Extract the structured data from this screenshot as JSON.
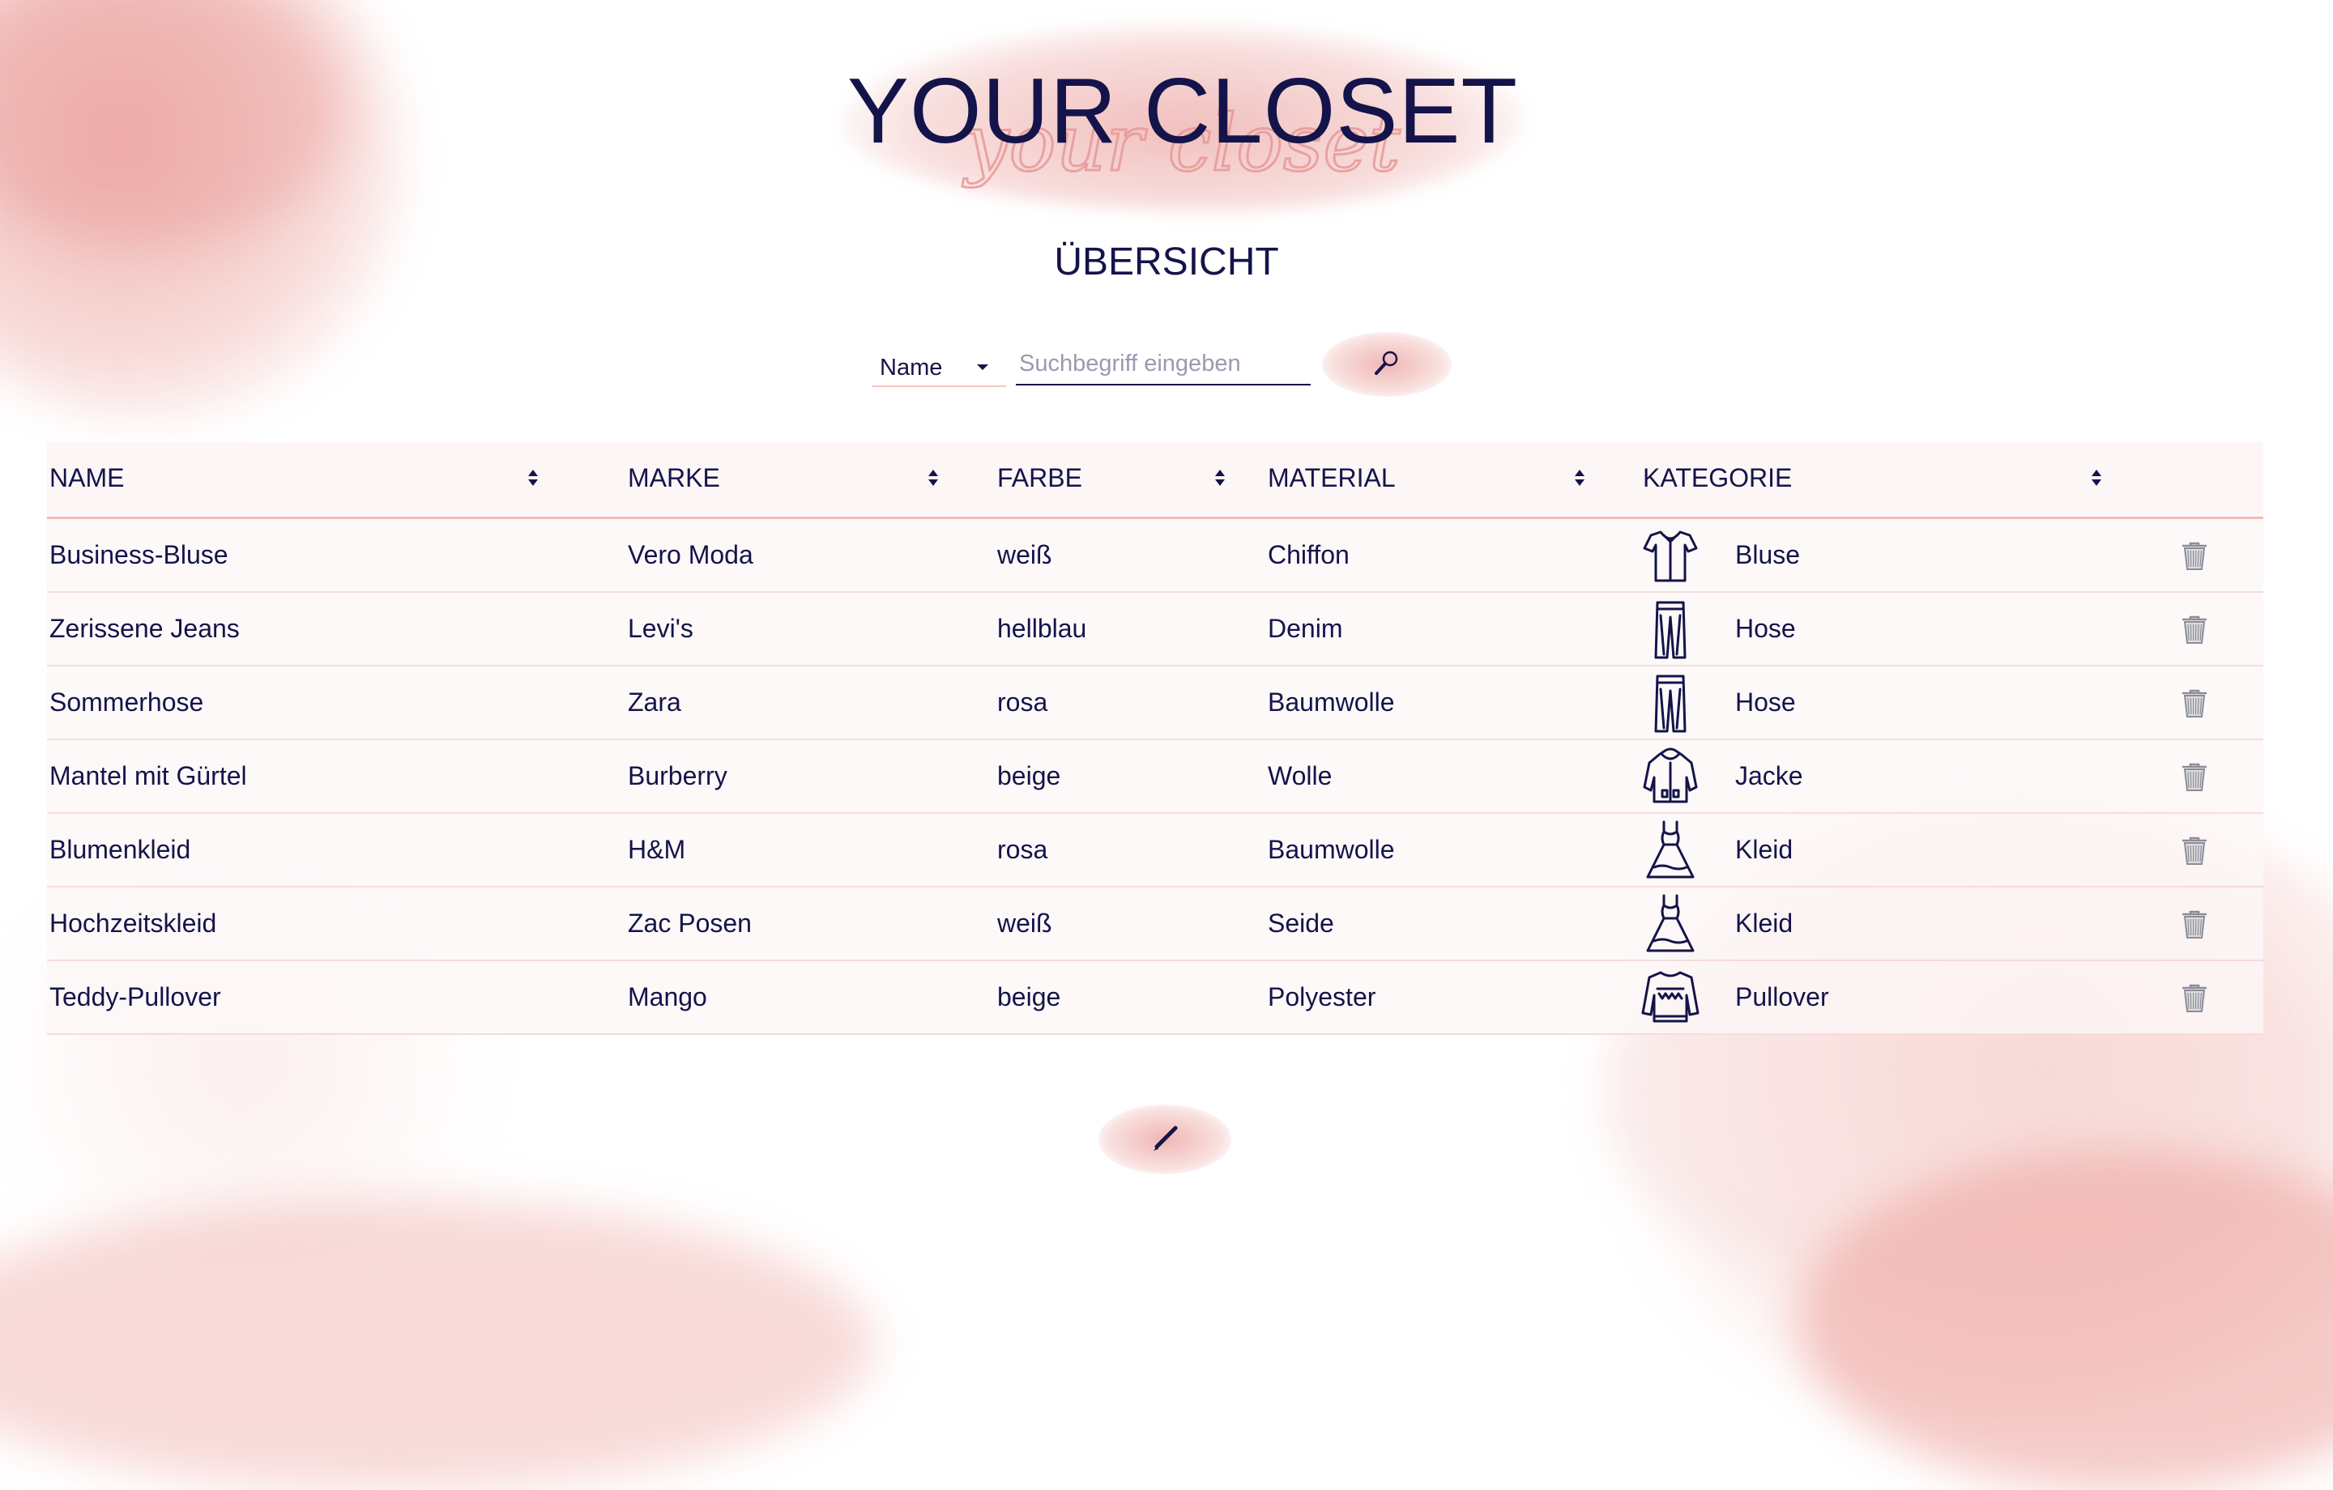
{
  "header": {
    "title": "YOUR CLOSET",
    "script_text": "your closet"
  },
  "subtitle": "ÜBERSICHT",
  "search": {
    "field_selected": "Name",
    "placeholder": "Suchbegriff eingeben",
    "button_icon": "magnifier-icon"
  },
  "table": {
    "columns": [
      "NAME",
      "MARKE",
      "FARBE",
      "MATERIAL",
      "KATEGORIE"
    ],
    "rows": [
      {
        "name": "Business-Bluse",
        "brand": "Vero Moda",
        "color": "weiß",
        "material": "Chiffon",
        "category": "Bluse",
        "icon": "blouse-icon"
      },
      {
        "name": "Zerissene Jeans",
        "brand": "Levi's",
        "color": "hellblau",
        "material": "Denim",
        "category": "Hose",
        "icon": "pants-icon"
      },
      {
        "name": "Sommerhose",
        "brand": "Zara",
        "color": "rosa",
        "material": "Baumwolle",
        "category": "Hose",
        "icon": "pants-icon"
      },
      {
        "name": "Mantel mit Gürtel",
        "brand": "Burberry",
        "color": "beige",
        "material": "Wolle",
        "category": "Jacke",
        "icon": "jacket-icon"
      },
      {
        "name": "Blumenkleid",
        "brand": "H&M",
        "color": "rosa",
        "material": "Baumwolle",
        "category": "Kleid",
        "icon": "dress-icon"
      },
      {
        "name": "Hochzeitskleid",
        "brand": "Zac Posen",
        "color": "weiß",
        "material": "Seide",
        "category": "Kleid",
        "icon": "dress-icon"
      },
      {
        "name": "Teddy-Pullover",
        "brand": "Mango",
        "color": "beige",
        "material": "Polyester",
        "category": "Pullover",
        "icon": "sweater-icon"
      }
    ]
  },
  "colors": {
    "text": "#14144a",
    "accent": "#ecaaa6",
    "row_bg": "#fdf7f7"
  }
}
